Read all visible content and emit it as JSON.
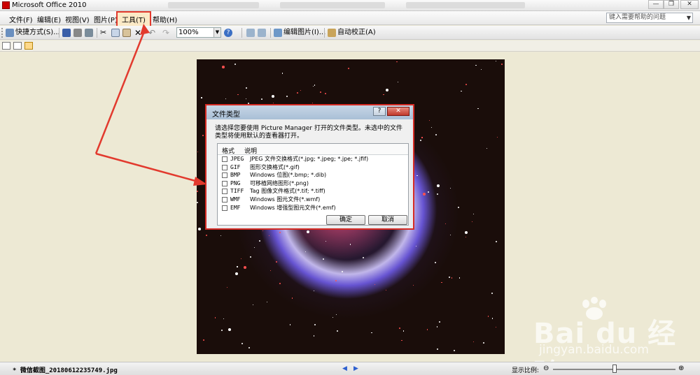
{
  "window": {
    "title": "Microsoft Office 2010",
    "buttons": {
      "minimize": "—",
      "restore": "❐",
      "close": "✕"
    }
  },
  "menubar": {
    "items": [
      "文件(F)",
      "编辑(E)",
      "视图(V)",
      "图片(P)",
      "工具(T)",
      "帮助(H)"
    ],
    "highlighted": "工具(T)",
    "help_placeholder": "键入需要帮助的问题"
  },
  "toolbar": {
    "shortcuts_label": "快捷方式(S)...",
    "zoom_value": "100%",
    "edit_picture_label": "编辑图片(I)...",
    "auto_correct_label": "自动校正(A)"
  },
  "dialog": {
    "title": "文件类型",
    "help_button": "?",
    "close_button": "✕",
    "description": "请选择您要使用 Picture Manager 打开的文件类型。未选中的文件类型将使用默认的查看器打开。",
    "columns": {
      "format": "格式",
      "description": "说明"
    },
    "file_types": [
      {
        "format": "JPEG",
        "description": "JPEG 文件交换格式(*.jpg; *.jpeg; *.jpe; *.jfif)",
        "checked": false
      },
      {
        "format": "GIF",
        "description": "图形交换格式(*.gif)",
        "checked": false
      },
      {
        "format": "BMP",
        "description": "Windows 位图(*.bmp; *.dib)",
        "checked": false
      },
      {
        "format": "PNG",
        "description": "可移植网络图形(*.png)",
        "checked": false
      },
      {
        "format": "TIFF",
        "description": "Tag 图像文件格式(*.tif; *.tiff)",
        "checked": false
      },
      {
        "format": "WMF",
        "description": "Windows 图元文件(*.wmf)",
        "checked": false
      },
      {
        "format": "EMF",
        "description": "Windows 增强型图元文件(*.emf)",
        "checked": false
      }
    ],
    "ok_label": "确定",
    "cancel_label": "取消"
  },
  "statusbar": {
    "filename": "* 微信截图_20180612235749.jpg",
    "zoom_label": "显示比例:",
    "zoom_level": 0.5
  },
  "watermark": {
    "brand": "Bai du 经验",
    "url": "jingyan.baidu.com"
  },
  "colors": {
    "annotation": "#e23a2e",
    "dialog_border": "#d62b24"
  }
}
